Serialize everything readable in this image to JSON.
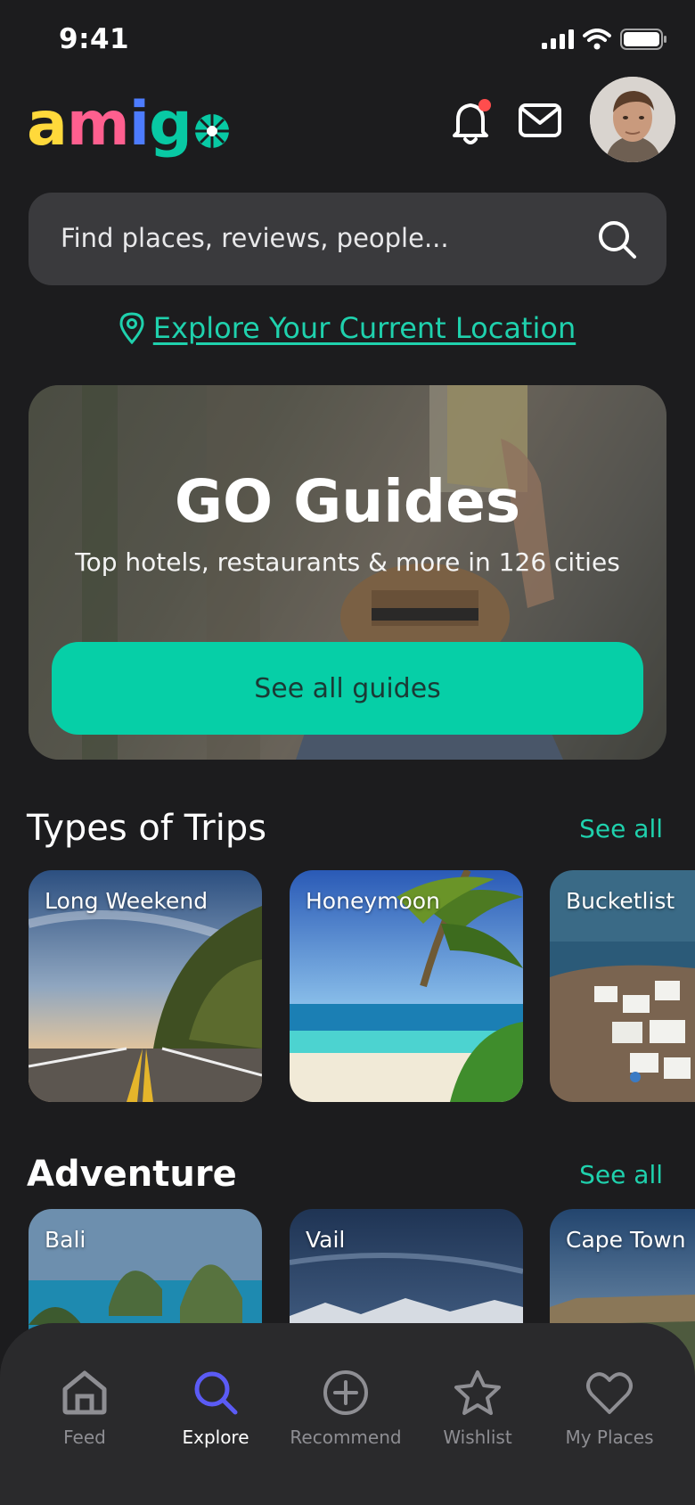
{
  "status": {
    "time": "9:41"
  },
  "header": {
    "logo_letters": [
      "a",
      "m",
      "i",
      "g"
    ],
    "logo_colors": [
      "#ffd93b",
      "#ff5f8f",
      "#4d7cff",
      "#08c9a4"
    ]
  },
  "search": {
    "placeholder": "Find places, reviews, people..."
  },
  "location": {
    "link": "Explore Your Current Location"
  },
  "hero": {
    "title": "GO Guides",
    "subtitle": "Top hotels, restaurants & more in 126 cities",
    "button": "See all guides"
  },
  "trips": {
    "title": "Types of Trips",
    "see_all": "See all",
    "items": [
      {
        "label": "Long Weekend"
      },
      {
        "label": "Honeymoon"
      },
      {
        "label": "Bucketlist"
      }
    ]
  },
  "adventure": {
    "title": "Adventure",
    "see_all": "See all",
    "items": [
      {
        "label": "Bali"
      },
      {
        "label": "Vail"
      },
      {
        "label": "Cape Town"
      }
    ]
  },
  "tabs": [
    {
      "label": "Feed",
      "icon": "home-icon"
    },
    {
      "label": "Explore",
      "icon": "search-icon",
      "active": true
    },
    {
      "label": "Recommend",
      "icon": "plus-circle-icon"
    },
    {
      "label": "Wishlist",
      "icon": "star-icon"
    },
    {
      "label": "My Places",
      "icon": "heart-icon"
    }
  ],
  "colors": {
    "background": "#1c1c1e",
    "accent": "#06cfa7",
    "active_tab": "#5b5bf5",
    "notification_dot": "#ff4d4d"
  }
}
